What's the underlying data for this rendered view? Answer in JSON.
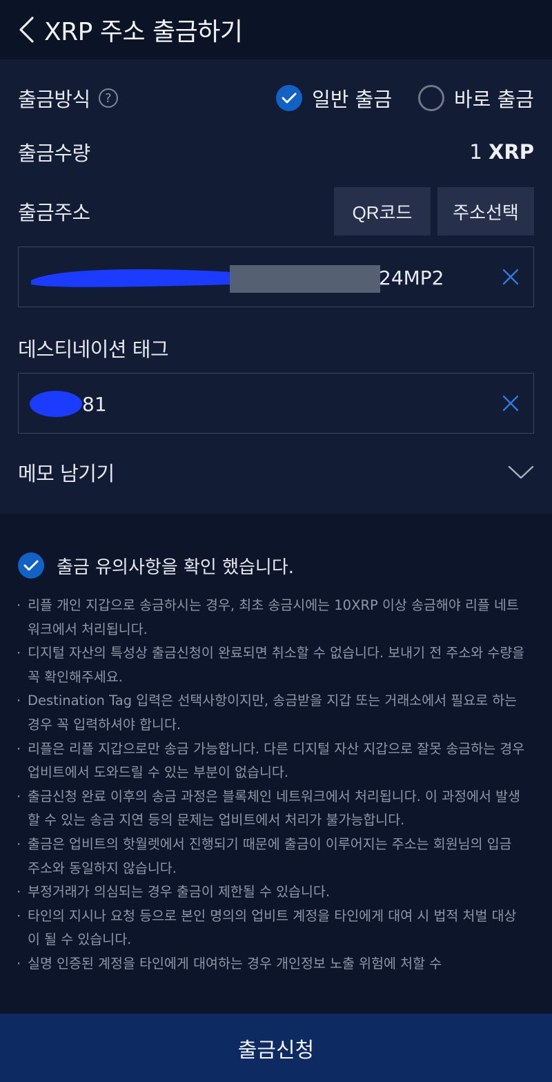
{
  "header": {
    "title": "XRP 주소 출금하기"
  },
  "form": {
    "method_label": "출금방식",
    "method_help": "?",
    "method_options": [
      {
        "label": "일반 출금",
        "selected": true
      },
      {
        "label": "바로 출금",
        "selected": false
      }
    ],
    "amount_label": "출금수량",
    "amount_value": "1",
    "amount_unit": "XRP",
    "address_label": "출금주소",
    "qr_button": "QR코드",
    "address_select_button": "주소선택",
    "address_value": "24MP2",
    "tag_label": "데스티네이션 태그",
    "tag_value": "81",
    "memo_label": "메모 남기기"
  },
  "notice": {
    "confirm_text": "출금 유의사항을 확인 했습니다.",
    "items": [
      "리플 개인 지갑으로 송금하시는 경우, 최초 송금시에는 10XRP 이상 송금해야 리플 네트워크에서 처리됩니다.",
      "디지털 자산의 특성상 출금신청이 완료되면 취소할 수 없습니다. 보내기 전 주소와 수량을 꼭 확인해주세요.",
      "Destination Tag 입력은 선택사항이지만, 송금받을 지갑 또는 거래소에서 필요로 하는 경우 꼭 입력하셔야 합니다.",
      "리플은 리플 지갑으로만 송금 가능합니다. 다른 디지털 자산 지갑으로 잘못 송금하는 경우 업비트에서 도와드릴 수 있는 부분이 없습니다.",
      "출금신청 완료 이후의 송금 과정은 블록체인 네트워크에서 처리됩니다. 이 과정에서 발생할 수 있는 송금 지연 등의 문제는 업비트에서 처리가 불가능합니다.",
      "출금은 업비트의 핫월렛에서 진행되기 때문에 출금이 이루어지는 주소는 회원님의 입금 주소와 동일하지 않습니다.",
      "부정거래가 의심되는 경우 출금이 제한될 수 있습니다.",
      "타인의 지시나 요청 등으로 본인 명의의 업비트 계정을 타인에게 대여 시 법적 처벌 대상이 될 수 있습니다.",
      "실명 인증된 계정을 타인에게 대여하는 경우 개인정보 노출 위험에 처할 수"
    ]
  },
  "submit_label": "출금신청"
}
